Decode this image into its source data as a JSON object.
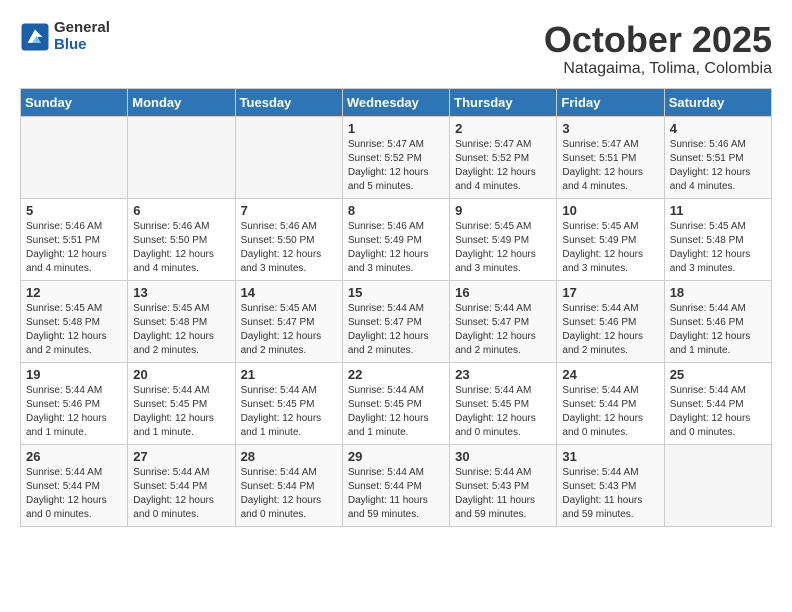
{
  "header": {
    "logo_general": "General",
    "logo_blue": "Blue",
    "month_year": "October 2025",
    "location": "Natagaima, Tolima, Colombia"
  },
  "weekdays": [
    "Sunday",
    "Monday",
    "Tuesday",
    "Wednesday",
    "Thursday",
    "Friday",
    "Saturday"
  ],
  "weeks": [
    [
      {
        "day": "",
        "info": ""
      },
      {
        "day": "",
        "info": ""
      },
      {
        "day": "",
        "info": ""
      },
      {
        "day": "1",
        "info": "Sunrise: 5:47 AM\nSunset: 5:52 PM\nDaylight: 12 hours\nand 5 minutes."
      },
      {
        "day": "2",
        "info": "Sunrise: 5:47 AM\nSunset: 5:52 PM\nDaylight: 12 hours\nand 4 minutes."
      },
      {
        "day": "3",
        "info": "Sunrise: 5:47 AM\nSunset: 5:51 PM\nDaylight: 12 hours\nand 4 minutes."
      },
      {
        "day": "4",
        "info": "Sunrise: 5:46 AM\nSunset: 5:51 PM\nDaylight: 12 hours\nand 4 minutes."
      }
    ],
    [
      {
        "day": "5",
        "info": "Sunrise: 5:46 AM\nSunset: 5:51 PM\nDaylight: 12 hours\nand 4 minutes."
      },
      {
        "day": "6",
        "info": "Sunrise: 5:46 AM\nSunset: 5:50 PM\nDaylight: 12 hours\nand 4 minutes."
      },
      {
        "day": "7",
        "info": "Sunrise: 5:46 AM\nSunset: 5:50 PM\nDaylight: 12 hours\nand 3 minutes."
      },
      {
        "day": "8",
        "info": "Sunrise: 5:46 AM\nSunset: 5:49 PM\nDaylight: 12 hours\nand 3 minutes."
      },
      {
        "day": "9",
        "info": "Sunrise: 5:45 AM\nSunset: 5:49 PM\nDaylight: 12 hours\nand 3 minutes."
      },
      {
        "day": "10",
        "info": "Sunrise: 5:45 AM\nSunset: 5:49 PM\nDaylight: 12 hours\nand 3 minutes."
      },
      {
        "day": "11",
        "info": "Sunrise: 5:45 AM\nSunset: 5:48 PM\nDaylight: 12 hours\nand 3 minutes."
      }
    ],
    [
      {
        "day": "12",
        "info": "Sunrise: 5:45 AM\nSunset: 5:48 PM\nDaylight: 12 hours\nand 2 minutes."
      },
      {
        "day": "13",
        "info": "Sunrise: 5:45 AM\nSunset: 5:48 PM\nDaylight: 12 hours\nand 2 minutes."
      },
      {
        "day": "14",
        "info": "Sunrise: 5:45 AM\nSunset: 5:47 PM\nDaylight: 12 hours\nand 2 minutes."
      },
      {
        "day": "15",
        "info": "Sunrise: 5:44 AM\nSunset: 5:47 PM\nDaylight: 12 hours\nand 2 minutes."
      },
      {
        "day": "16",
        "info": "Sunrise: 5:44 AM\nSunset: 5:47 PM\nDaylight: 12 hours\nand 2 minutes."
      },
      {
        "day": "17",
        "info": "Sunrise: 5:44 AM\nSunset: 5:46 PM\nDaylight: 12 hours\nand 2 minutes."
      },
      {
        "day": "18",
        "info": "Sunrise: 5:44 AM\nSunset: 5:46 PM\nDaylight: 12 hours\nand 1 minute."
      }
    ],
    [
      {
        "day": "19",
        "info": "Sunrise: 5:44 AM\nSunset: 5:46 PM\nDaylight: 12 hours\nand 1 minute."
      },
      {
        "day": "20",
        "info": "Sunrise: 5:44 AM\nSunset: 5:45 PM\nDaylight: 12 hours\nand 1 minute."
      },
      {
        "day": "21",
        "info": "Sunrise: 5:44 AM\nSunset: 5:45 PM\nDaylight: 12 hours\nand 1 minute."
      },
      {
        "day": "22",
        "info": "Sunrise: 5:44 AM\nSunset: 5:45 PM\nDaylight: 12 hours\nand 1 minute."
      },
      {
        "day": "23",
        "info": "Sunrise: 5:44 AM\nSunset: 5:45 PM\nDaylight: 12 hours\nand 0 minutes."
      },
      {
        "day": "24",
        "info": "Sunrise: 5:44 AM\nSunset: 5:44 PM\nDaylight: 12 hours\nand 0 minutes."
      },
      {
        "day": "25",
        "info": "Sunrise: 5:44 AM\nSunset: 5:44 PM\nDaylight: 12 hours\nand 0 minutes."
      }
    ],
    [
      {
        "day": "26",
        "info": "Sunrise: 5:44 AM\nSunset: 5:44 PM\nDaylight: 12 hours\nand 0 minutes."
      },
      {
        "day": "27",
        "info": "Sunrise: 5:44 AM\nSunset: 5:44 PM\nDaylight: 12 hours\nand 0 minutes."
      },
      {
        "day": "28",
        "info": "Sunrise: 5:44 AM\nSunset: 5:44 PM\nDaylight: 12 hours\nand 0 minutes."
      },
      {
        "day": "29",
        "info": "Sunrise: 5:44 AM\nSunset: 5:44 PM\nDaylight: 11 hours\nand 59 minutes."
      },
      {
        "day": "30",
        "info": "Sunrise: 5:44 AM\nSunset: 5:43 PM\nDaylight: 11 hours\nand 59 minutes."
      },
      {
        "day": "31",
        "info": "Sunrise: 5:44 AM\nSunset: 5:43 PM\nDaylight: 11 hours\nand 59 minutes."
      },
      {
        "day": "",
        "info": ""
      }
    ]
  ]
}
